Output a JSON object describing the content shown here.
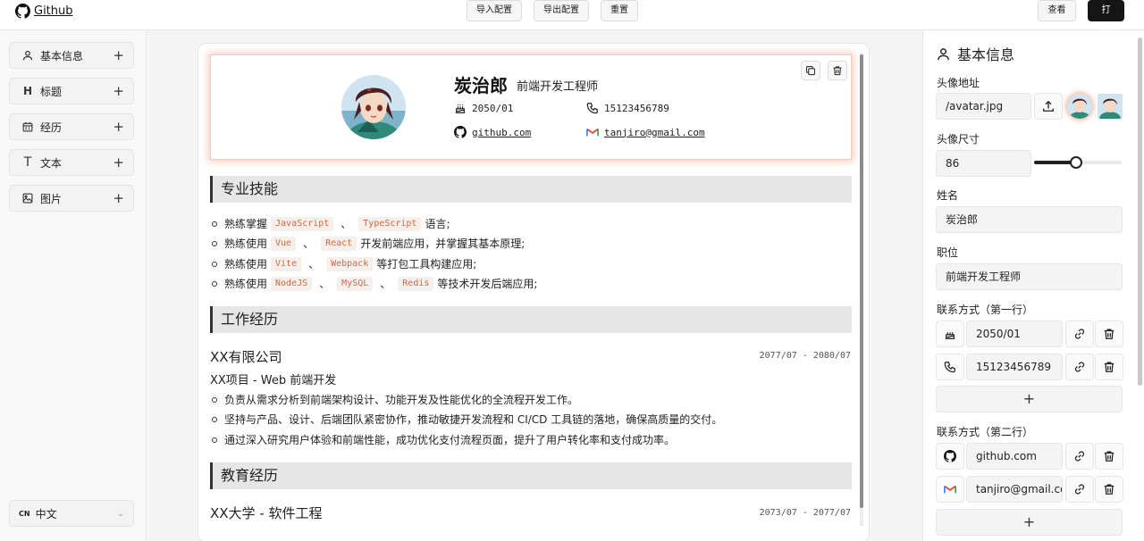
{
  "topbar": {
    "brand": "Github",
    "import_label": "导入配置",
    "export_label": "导出配置",
    "reset_label": "重置",
    "view_label": "查看",
    "print_label": "打印"
  },
  "sidebar": {
    "items": [
      {
        "label": "基本信息",
        "icon": "user-icon"
      },
      {
        "label": "标题",
        "icon": "heading-icon"
      },
      {
        "label": "经历",
        "icon": "calendar-icon"
      },
      {
        "label": "文本",
        "icon": "text-icon"
      },
      {
        "label": "图片",
        "icon": "image-icon"
      }
    ],
    "lang_code": "CN",
    "lang_label": "中文"
  },
  "resume": {
    "name": "炭治郎",
    "role": "前端开发工程师",
    "birth": "2050/01",
    "phone": "15123456789",
    "github": "github.com",
    "email": "tanjiro@gmail.com",
    "skills_title": "专业技能",
    "skills": [
      {
        "pre": "熟练掌握",
        "codes": [
          "JavaScript",
          "TypeScript"
        ],
        "post": "语言;"
      },
      {
        "pre": "熟练使用",
        "codes": [
          "Vue",
          "React"
        ],
        "post": "开发前端应用，并掌握其基本原理;"
      },
      {
        "pre": "熟练使用",
        "codes": [
          "Vite",
          "Webpack"
        ],
        "post": "等打包工具构建应用;"
      },
      {
        "pre": "熟练使用",
        "codes": [
          "NodeJS",
          "MySQL",
          "Redis"
        ],
        "post": "等技术开发后端应用;"
      }
    ],
    "work_title": "工作经历",
    "company": "XX有限公司",
    "company_date": "2077/07 - 2080/07",
    "project": "XX项目 - Web 前端开发",
    "work_items": [
      "负责从需求分析到前端架构设计、功能开发及性能优化的全流程开发工作。",
      "坚持与产品、设计、后端团队紧密协作，推动敏捷开发流程和 CI/CD 工具链的落地，确保高质量的交付。",
      "通过深入研究用户体验和前端性能，成功优化支付流程页面，提升了用户转化率和支付成功率。"
    ],
    "edu_title": "教育经历",
    "school": "XX大学 - 软件工程",
    "school_date": "2073/07 - 2077/07"
  },
  "panel": {
    "title": "基本信息",
    "avatar_label": "头像地址",
    "avatar_value": "/avatar.jpg",
    "size_label": "头像尺寸",
    "size_value": "86",
    "size_fraction": 0.48,
    "name_label": "姓名",
    "name_value": "炭治郎",
    "role_label": "职位",
    "role_value": "前端开发工程师",
    "contact1_label": "联系方式（第一行）",
    "contact1": [
      {
        "icon": "cake-icon",
        "value": "2050/01"
      },
      {
        "icon": "phone-icon",
        "value": "15123456789"
      }
    ],
    "contact2_label": "联系方式（第二行）",
    "contact2": [
      {
        "icon": "github-icon",
        "value": "github.com"
      },
      {
        "icon": "gmail-icon",
        "value": "tanjiro@gmail.com"
      }
    ],
    "add_label": "+"
  },
  "colors": {
    "accent": "#151515",
    "code_text": "#d9663d",
    "card_glow": "#f0a082"
  }
}
